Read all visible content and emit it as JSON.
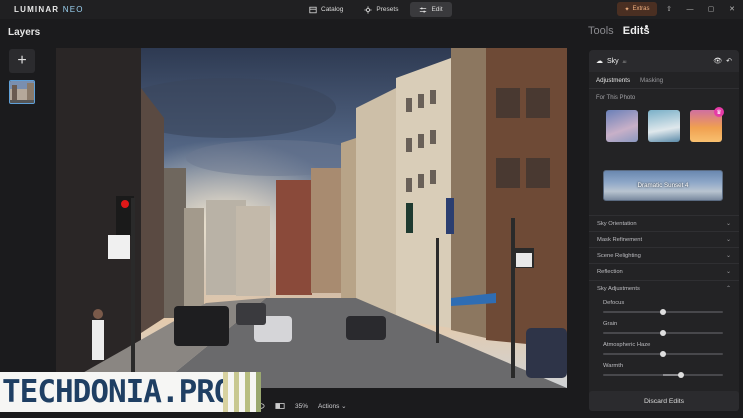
{
  "app": {
    "logo_main": "LUMINAR",
    "logo_sub": "NEO"
  },
  "topnav": {
    "catalog": "Catalog",
    "presets": "Presets",
    "edit": "Edit",
    "active": "Edit"
  },
  "titlebar": {
    "extras": "Extras"
  },
  "layers": {
    "title": "Layers",
    "add_label": "+"
  },
  "panel": {
    "tools_tab": "Tools",
    "edits_tab": "Edits",
    "tool_name": "Sky",
    "tool_badge": "AI",
    "subtabs": {
      "adjustments": "Adjustments",
      "masking": "Masking",
      "active": "Adjustments"
    },
    "for_photo": "For This Photo",
    "selected_sky": "Dramatic Sunset 4",
    "sections": [
      {
        "label": "Sky Orientation"
      },
      {
        "label": "Mask Refinement"
      },
      {
        "label": "Scene Relighting"
      },
      {
        "label": "Reflection"
      },
      {
        "label": "Sky Adjustments"
      }
    ],
    "sliders": [
      {
        "label": "Defocus",
        "value": 0
      },
      {
        "label": "Grain",
        "value": 0
      },
      {
        "label": "Atmospheric Haze",
        "value": 0
      },
      {
        "label": "Warmth",
        "value": 0.3
      }
    ],
    "discard": "Discard Edits"
  },
  "bottombar": {
    "zoom": "35%",
    "actions": "Actions"
  },
  "watermark": {
    "text": "TECHDONIA.PRO"
  },
  "icons": [
    "catalog-icon",
    "presets-icon",
    "edit-icon",
    "extras-icon",
    "share-icon",
    "minimize-icon",
    "maximize-icon",
    "close-icon",
    "cloud-icon",
    "eye-icon",
    "reset-icon",
    "chevron-down-icon",
    "compare-icon",
    "crown-icon"
  ],
  "colors": {
    "accent_blue": "#5fa0d8",
    "extras_bg": "#4a2f22",
    "premium_pink": "#e63aa7"
  }
}
